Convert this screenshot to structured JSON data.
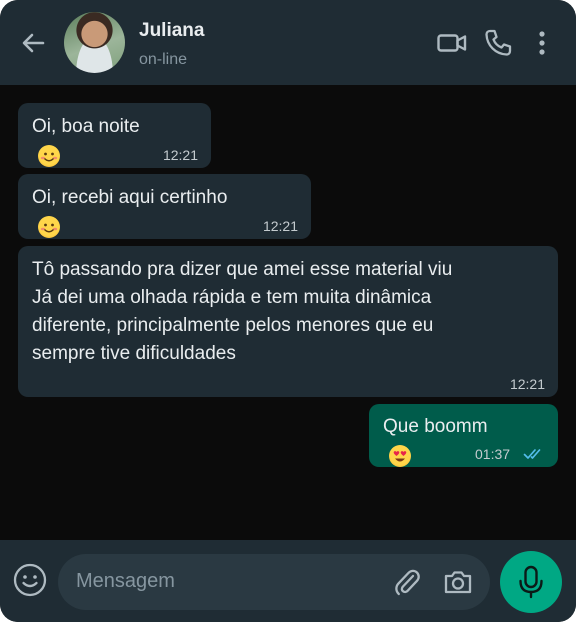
{
  "header": {
    "contact_name": "Juliana",
    "status": "on-line",
    "icons": [
      "back-arrow-icon",
      "video-call-icon",
      "phone-icon",
      "more-vert-icon"
    ]
  },
  "messages": [
    {
      "direction": "in",
      "text": "Oi, boa noite",
      "emoji": "smiling-face",
      "time": "12:21"
    },
    {
      "direction": "in",
      "text": "Oi, recebi aqui certinho",
      "emoji": "smiling-face",
      "time": "12:21"
    },
    {
      "direction": "in",
      "text": "Tô passando pra dizer que amei esse material viu\nJá dei uma olhada rápida e tem muita dinâmica\ndiferente, principalmente pelos menores que eu\nsempre tive dificuldades",
      "time": "12:21"
    },
    {
      "direction": "out",
      "text": "Que boomm",
      "emoji": "heart-eyes",
      "time": "01:37",
      "read": true
    }
  ],
  "composer": {
    "placeholder": "Mensagem",
    "icons": [
      "emoji-icon",
      "attach-icon",
      "camera-icon",
      "mic-icon"
    ]
  },
  "colors": {
    "header_bg": "#1f2c34",
    "chat_bg": "#0b0b0b",
    "incoming_bubble": "#1f2c34",
    "outgoing_bubble": "#005c4b",
    "accent": "#00a884",
    "read_ticks": "#53bdeb"
  }
}
